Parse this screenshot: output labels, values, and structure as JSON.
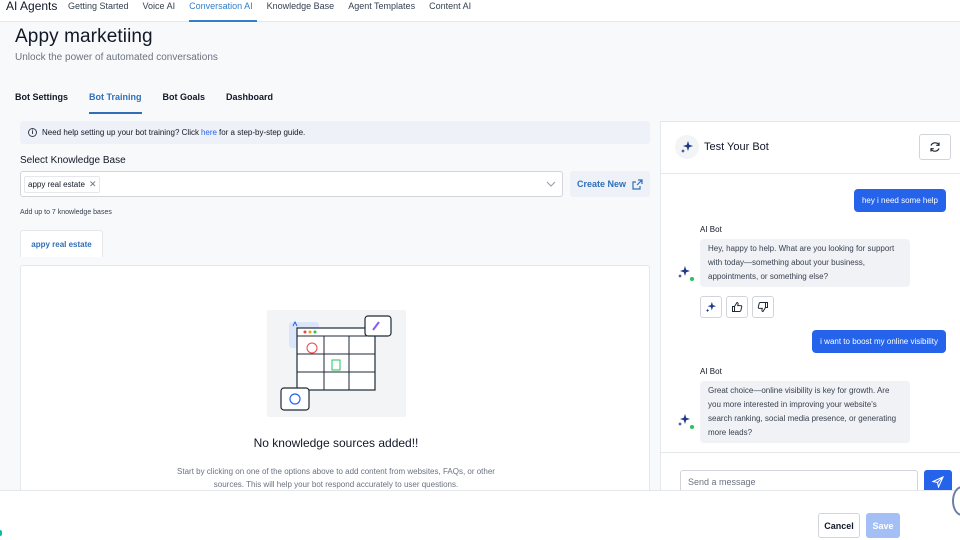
{
  "nav": {
    "brand": "AI Agents",
    "tabs": [
      "Getting Started",
      "Voice AI",
      "Conversation AI",
      "Knowledge Base",
      "Agent Templates",
      "Content AI"
    ],
    "active": "Conversation AI"
  },
  "header": {
    "title": "Appy marketiing",
    "subtitle": "Unlock the power of automated conversations"
  },
  "subtabs": [
    "Bot Settings",
    "Bot Training",
    "Bot Goals",
    "Dashboard"
  ],
  "help": {
    "before": "Need help setting up your bot training? Click",
    "link": "here",
    "after": "for a step-by-step guide."
  },
  "kb": {
    "label": "Select Knowledge Base",
    "selected": "appy real estate",
    "create_new": "Create New",
    "hint": "Add up to 7 knowledge bases",
    "tab": "appy real estate",
    "empty_title": "No knowledge sources added!!",
    "empty_desc": "Start by clicking on one of the options above to add content from websites, FAQs, or other sources. This will help your bot respond accurately to user questions."
  },
  "chat": {
    "title": "Test Your Bot",
    "messages": [
      {
        "from": "user",
        "text": "hey i need some help"
      },
      {
        "from": "bot",
        "name": "AI Bot",
        "text": "Hey, happy to help. What are you looking for support with today—something about your business, appointments, or something else?"
      },
      {
        "from": "user",
        "text": "i want to boost my online visibility"
      },
      {
        "from": "bot",
        "name": "AI Bot",
        "text": "Great choice—online visibility is key for growth. Are you more interested in improving your website's search ranking, social media presence, or generating more leads?"
      }
    ],
    "input_placeholder": "Send a message"
  },
  "footer": {
    "cancel": "Cancel",
    "save": "Save"
  },
  "colors": {
    "accent": "#2563eb",
    "active_tab": "#2f7fc9",
    "online": "#22c55e"
  }
}
